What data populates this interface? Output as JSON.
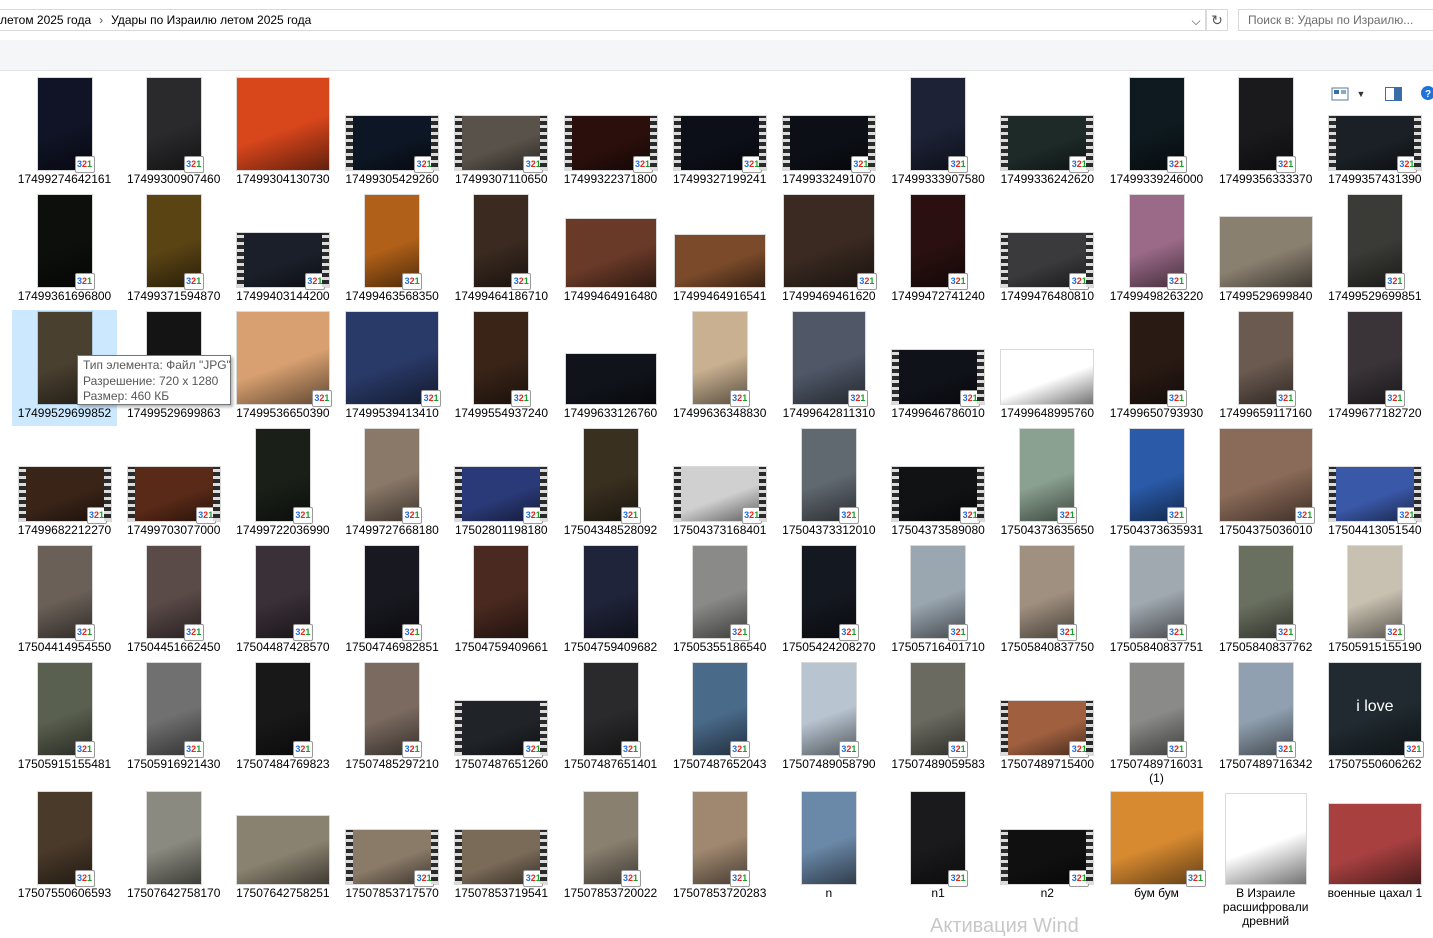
{
  "address": {
    "crumbs": [
      "летом 2025 года",
      "Удары по Израилю летом 2025 года"
    ],
    "separator": "›",
    "search_placeholder": "Поиск в: Удары по Израилю..."
  },
  "tooltip": {
    "type": "Тип элемента: Файл \"JPG\"",
    "resolution": "Разрешение: 720 x 1280",
    "size": "Размер: 460 КБ"
  },
  "watermark": "Активация Wind",
  "items": [
    {
      "name": "17499274642161",
      "kind": "portrait",
      "color": "#101426",
      "badge": true
    },
    {
      "name": "17499300907460",
      "kind": "portrait",
      "color": "#2a2a2c",
      "badge": true
    },
    {
      "name": "17499304130730",
      "kind": "square",
      "color": "#d8461c",
      "badge": false
    },
    {
      "name": "17499305429260",
      "kind": "film",
      "color": "#0d1624",
      "badge": true
    },
    {
      "name": "17499307110650",
      "kind": "film",
      "color": "#59524a",
      "badge": true
    },
    {
      "name": "17499322371800",
      "kind": "film",
      "color": "#2a0f0c",
      "badge": true
    },
    {
      "name": "17499327199241",
      "kind": "film",
      "color": "#0c0f18",
      "badge": true
    },
    {
      "name": "17499332491070",
      "kind": "film",
      "color": "#0c0f16",
      "badge": true
    },
    {
      "name": "17499333907580",
      "kind": "portrait",
      "color": "#1d2236",
      "badge": true
    },
    {
      "name": "17499336242620",
      "kind": "film",
      "color": "#1d2a28",
      "badge": true
    },
    {
      "name": "17499339246000",
      "kind": "portrait",
      "color": "#0e1a20",
      "badge": true
    },
    {
      "name": "17499356333370",
      "kind": "portrait",
      "color": "#1a1a1d",
      "badge": true
    },
    {
      "name": "17499357431390",
      "kind": "film",
      "color": "#1a2026",
      "badge": true
    },
    {
      "name": "17499361696800",
      "kind": "portrait",
      "color": "#0d0f0c",
      "badge": true
    },
    {
      "name": "17499371594870",
      "kind": "portrait",
      "color": "#5a4414",
      "badge": true
    },
    {
      "name": "17499403144200",
      "kind": "film",
      "color": "#1a1f29",
      "badge": true
    },
    {
      "name": "17499463568350",
      "kind": "portrait",
      "color": "#b06018",
      "badge": true
    },
    {
      "name": "17499464186710",
      "kind": "portrait",
      "color": "#3a2a20",
      "badge": true
    },
    {
      "name": "17499464916480",
      "kind": "landscape",
      "color": "#6a3a28",
      "badge": false
    },
    {
      "name": "17499464916541",
      "kind": "landscape2",
      "color": "#7a4a2a",
      "badge": false
    },
    {
      "name": "17499469461620",
      "kind": "square2",
      "color": "#3a2a22",
      "badge": true
    },
    {
      "name": "17499472741240",
      "kind": "portrait",
      "color": "#2a1010",
      "badge": true
    },
    {
      "name": "17499476480810",
      "kind": "film",
      "color": "#3a3a3c",
      "badge": true
    },
    {
      "name": "17499498263220",
      "kind": "portrait",
      "color": "#9a6a88",
      "badge": true
    },
    {
      "name": "17499529699840",
      "kind": "landscape3",
      "color": "#8a8070",
      "badge": false
    },
    {
      "name": "17499529699851",
      "kind": "portrait",
      "color": "#3a3a36",
      "badge": true
    },
    {
      "name": "17499529699852",
      "kind": "portrait",
      "color": "#4a4030",
      "badge": false
    },
    {
      "name": "17499529699863",
      "kind": "portrait",
      "color": "#141414",
      "badge": false
    },
    {
      "name": "17499536650390",
      "kind": "square",
      "color": "#d8a070",
      "badge": true
    },
    {
      "name": "17499539413410",
      "kind": "square",
      "color": "#2a3a68",
      "badge": true
    },
    {
      "name": "17499554937240",
      "kind": "portrait",
      "color": "#3a2418",
      "badge": true
    },
    {
      "name": "17499633126760",
      "kind": "tweet",
      "color": "#10131a",
      "badge": false
    },
    {
      "name": "17499636348830",
      "kind": "portrait",
      "color": "#c8b090",
      "badge": true
    },
    {
      "name": "17499642811310",
      "kind": "square3",
      "color": "#505868",
      "badge": true
    },
    {
      "name": "17499646786010",
      "kind": "film",
      "color": "#10121a",
      "badge": true
    },
    {
      "name": "17499648995760",
      "kind": "tweet2",
      "color": "#ffffff",
      "badge": false
    },
    {
      "name": "17499650793930",
      "kind": "portrait",
      "color": "#2a1a14",
      "badge": true
    },
    {
      "name": "17499659117160",
      "kind": "portrait",
      "color": "#6a5a50",
      "badge": true
    },
    {
      "name": "17499677182720",
      "kind": "portrait",
      "color": "#3a3438",
      "badge": true
    },
    {
      "name": "17499682212270",
      "kind": "film",
      "color": "#3a2418",
      "badge": true
    },
    {
      "name": "17499703077000",
      "kind": "film",
      "color": "#5a2a18",
      "badge": true
    },
    {
      "name": "17499722036990",
      "kind": "portrait",
      "color": "#1a2018",
      "badge": true
    },
    {
      "name": "17499727668180",
      "kind": "portrait",
      "color": "#8a7868",
      "badge": true
    },
    {
      "name": "17502801198180",
      "kind": "film",
      "color": "#2a3a78",
      "badge": true
    },
    {
      "name": "17504348528092",
      "kind": "portrait",
      "color": "#3a3020",
      "badge": true
    },
    {
      "name": "17504373168401",
      "kind": "film",
      "color": "#d0d0d0",
      "badge": true
    },
    {
      "name": "17504373312010",
      "kind": "portrait",
      "color": "#606870",
      "badge": true
    },
    {
      "name": "17504373589080",
      "kind": "film",
      "color": "#101214",
      "badge": true
    },
    {
      "name": "17504373635650",
      "kind": "portrait",
      "color": "#8aa090",
      "badge": true
    },
    {
      "name": "17504373635931",
      "kind": "portrait",
      "color": "#2a5aa8",
      "badge": true
    },
    {
      "name": "17504375036010",
      "kind": "square4",
      "color": "#8a6a58",
      "badge": true
    },
    {
      "name": "17504413051540",
      "kind": "film",
      "color": "#3a58a8",
      "badge": true
    },
    {
      "name": "17504414954550",
      "kind": "portrait",
      "color": "#6a6058",
      "badge": true
    },
    {
      "name": "17504451662450",
      "kind": "portrait",
      "color": "#5a4a48",
      "badge": true
    },
    {
      "name": "17504487428570",
      "kind": "portrait",
      "color": "#3a3038",
      "badge": true
    },
    {
      "name": "17504746982851",
      "kind": "portrait",
      "color": "#181820",
      "badge": true
    },
    {
      "name": "17504759409661",
      "kind": "portrait",
      "color": "#4a2a20",
      "badge": false
    },
    {
      "name": "17504759409682",
      "kind": "portrait",
      "color": "#20243a",
      "badge": false
    },
    {
      "name": "17505355186540",
      "kind": "portrait",
      "color": "#8a8a88",
      "badge": true
    },
    {
      "name": "17505424208270",
      "kind": "portrait",
      "color": "#141820",
      "badge": true
    },
    {
      "name": "17505716401710",
      "kind": "portrait",
      "color": "#9aa6b0",
      "badge": true
    },
    {
      "name": "17505840837750",
      "kind": "portrait",
      "color": "#a09080",
      "badge": true
    },
    {
      "name": "17505840837751",
      "kind": "portrait",
      "color": "#a0a8b0",
      "badge": true
    },
    {
      "name": "17505840837762",
      "kind": "portrait",
      "color": "#6a7060",
      "badge": true
    },
    {
      "name": "17505915155190",
      "kind": "portrait",
      "color": "#c8c0b0",
      "badge": true
    },
    {
      "name": "17505915155481",
      "kind": "portrait",
      "color": "#5a6050",
      "badge": true
    },
    {
      "name": "17505916921430",
      "kind": "portrait",
      "color": "#707070",
      "badge": true
    },
    {
      "name": "17507484769823",
      "kind": "portrait",
      "color": "#181818",
      "badge": true
    },
    {
      "name": "17507485297210",
      "kind": "portrait",
      "color": "#7a6a60",
      "badge": true
    },
    {
      "name": "17507487651260",
      "kind": "film",
      "color": "#202428",
      "badge": true
    },
    {
      "name": "17507487651401",
      "kind": "portrait",
      "color": "#2a2a2c",
      "badge": true
    },
    {
      "name": "17507487652043",
      "kind": "portrait",
      "color": "#4a6a8a",
      "badge": true
    },
    {
      "name": "17507489058790",
      "kind": "portrait",
      "color": "#b8c4d0",
      "badge": true
    },
    {
      "name": "17507489059583",
      "kind": "portrait",
      "color": "#6a6a60",
      "badge": true
    },
    {
      "name": "17507489715400",
      "kind": "film",
      "color": "#a06040",
      "badge": true
    },
    {
      "name": "17507489716031 (1)",
      "kind": "portrait",
      "color": "#8a8a88",
      "badge": true
    },
    {
      "name": "17507489716342",
      "kind": "portrait",
      "color": "#90a0b0",
      "badge": true
    },
    {
      "name": "17507550606262",
      "kind": "square5",
      "color": "#202a30",
      "badge": true,
      "overtext": "i love"
    },
    {
      "name": "17507550606593",
      "kind": "portrait",
      "color": "#4a3a2a",
      "badge": true
    },
    {
      "name": "17507642758170",
      "kind": "portrait",
      "color": "#8a8a80",
      "badge": false
    },
    {
      "name": "17507642758251",
      "kind": "landscape4",
      "color": "#8a8270",
      "badge": false
    },
    {
      "name": "17507853717570",
      "kind": "film",
      "color": "#8a7a68",
      "badge": true
    },
    {
      "name": "17507853719541",
      "kind": "film",
      "color": "#7a6a58",
      "badge": true
    },
    {
      "name": "17507853720022",
      "kind": "portrait",
      "color": "#8a8070",
      "badge": true
    },
    {
      "name": "17507853720283",
      "kind": "portrait",
      "color": "#a08870",
      "badge": true
    },
    {
      "name": "n",
      "kind": "portrait",
      "color": "#6a88a8",
      "badge": false
    },
    {
      "name": "n1",
      "kind": "portrait",
      "color": "#1a1a1c",
      "badge": true
    },
    {
      "name": "n2",
      "kind": "film",
      "color": "#101010",
      "badge": true
    },
    {
      "name": "бум бум",
      "kind": "square6",
      "color": "#d88a30",
      "badge": true
    },
    {
      "name": "В Израиле расшифровали древний",
      "kind": "tweet3",
      "color": "#ffffff",
      "badge": false
    },
    {
      "name": "военные цахал 1",
      "kind": "square7",
      "color": "#a84040",
      "badge": false
    }
  ]
}
